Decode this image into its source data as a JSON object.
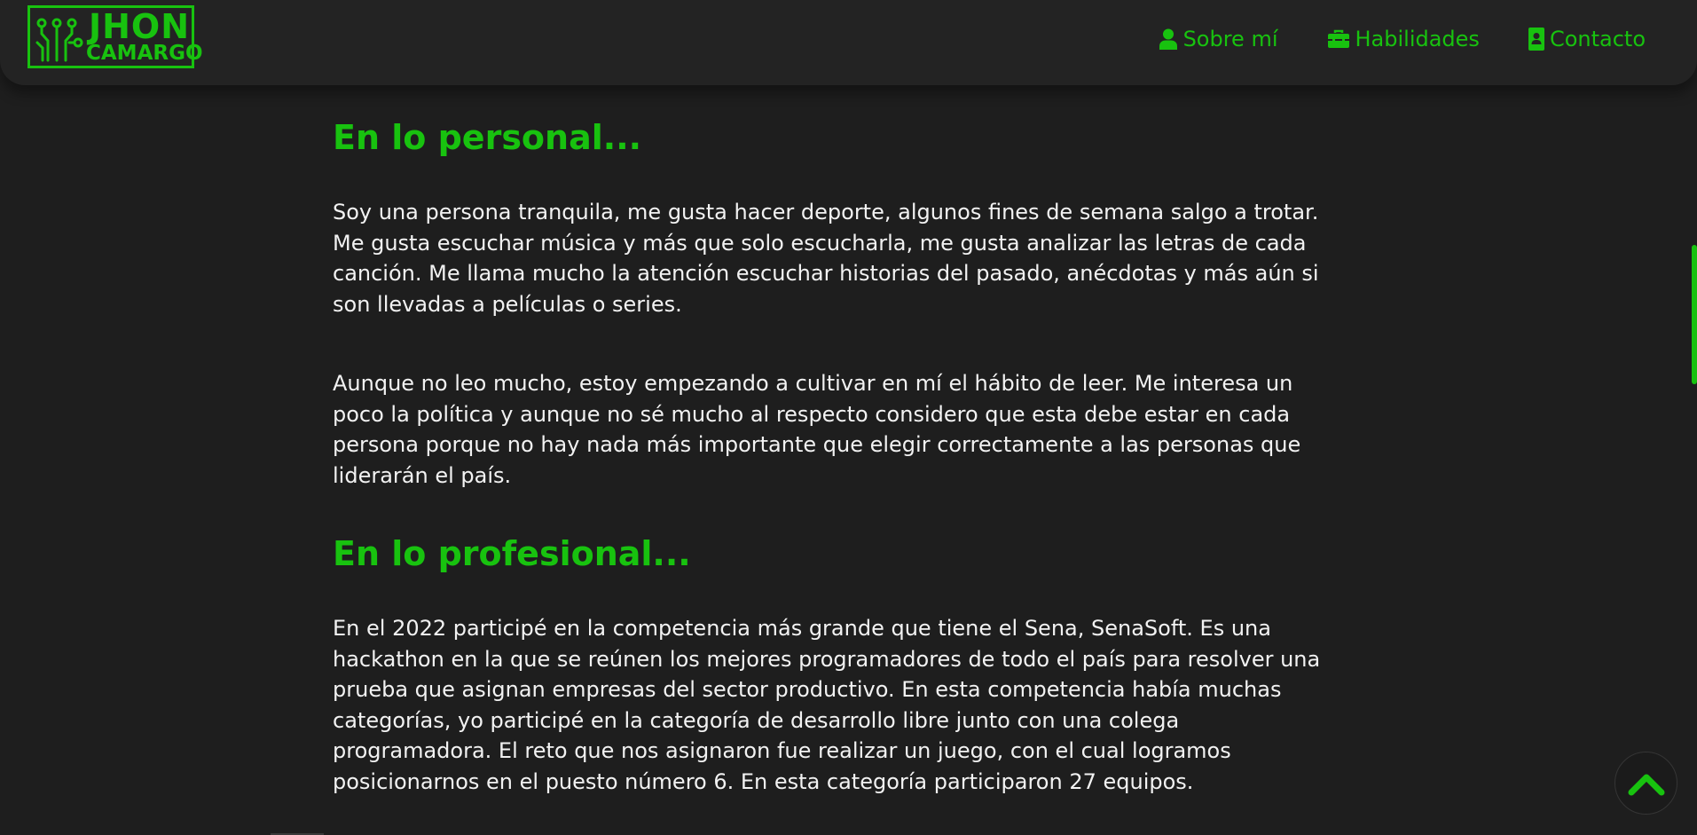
{
  "brand": {
    "line1": "JHON",
    "line2": "CAMARGO",
    "icon": "circuit-icon",
    "color": "#18c20f"
  },
  "nav": {
    "items": [
      {
        "label": "Sobre mí",
        "icon": "user-icon"
      },
      {
        "label": "Habilidades",
        "icon": "toolbox-icon"
      },
      {
        "label": "Contacto",
        "icon": "contact-card-icon"
      }
    ]
  },
  "main": {
    "personal": {
      "heading": "En lo personal...",
      "paragraphs": [
        "Soy una persona tranquila, me gusta hacer deporte, algunos fines de semana salgo a trotar. Me gusta escuchar música y más que solo escucharla, me gusta analizar las letras de cada canción. Me llama mucho la atención escuchar historias del pasado, anécdotas y más aún si son llevadas a películas o series.",
        "Aunque no leo mucho, estoy empezando a cultivar en mí el hábito de leer. Me interesa un poco la política y aunque no sé mucho al respecto considero que esta debe estar en cada persona porque no hay nada más importante que elegir correctamente a las personas que liderarán el país."
      ]
    },
    "profesional": {
      "heading": "En lo profesional...",
      "paragraphs": [
        "En el 2022 participé en la competencia más grande que tiene el Sena, SenaSoft. Es una hackathon en la que se reúnen los mejores programadores de todo el país para resolver una prueba que asignan empresas del sector productivo. En esta competencia había muchas categorías, yo participé en la categoría de desarrollo libre junto con una colega programadora. El reto que nos asignaron fue realizar un juego, con el cual logramos posicionarnos en el puesto número 6. En esta categoría participaron 27 equipos."
      ]
    }
  },
  "back_to_top": {
    "icon": "chevron-up-icon"
  },
  "colors": {
    "accent": "#18c20f",
    "background": "#1e1e1e",
    "header": "#232323",
    "text": "#f2f2f2"
  }
}
